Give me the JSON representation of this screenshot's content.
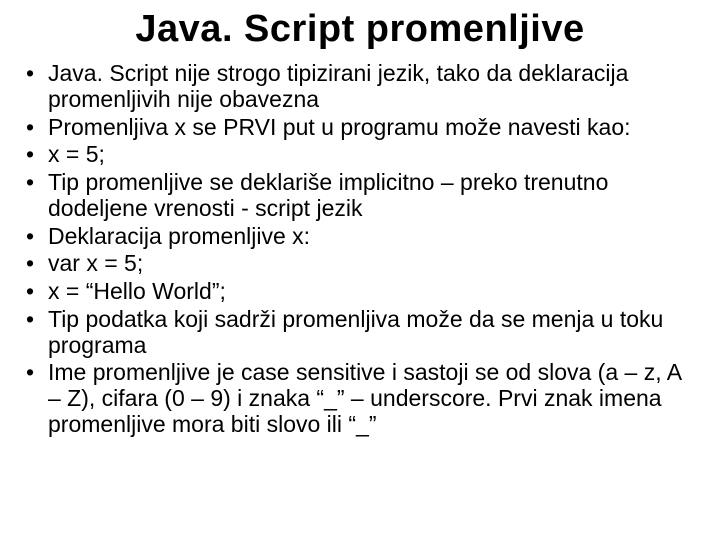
{
  "title": "Java. Script promenljive",
  "bullets": [
    "Java. Script nije strogo tipizirani jezik, tako da deklaracija promenljivih nije obavezna",
    "Promenljiva x se PRVI put u programu može navesti kao:",
    "x = 5;",
    "Tip promenljive se deklariše implicitno – preko trenutno dodeljene vrenosti - script jezik",
    "Deklaracija promenljive x:",
    "var x = 5;",
    "x = “Hello World”;",
    "Tip podatka koji sadrži promenljiva može da se menja u toku programa",
    "Ime promenljive je case sensitive i sastoji se od slova (a – z, A – Z), cifara (0 – 9) i znaka “_” – underscore. Prvi znak imena promenljive mora biti slovo ili “_”"
  ]
}
